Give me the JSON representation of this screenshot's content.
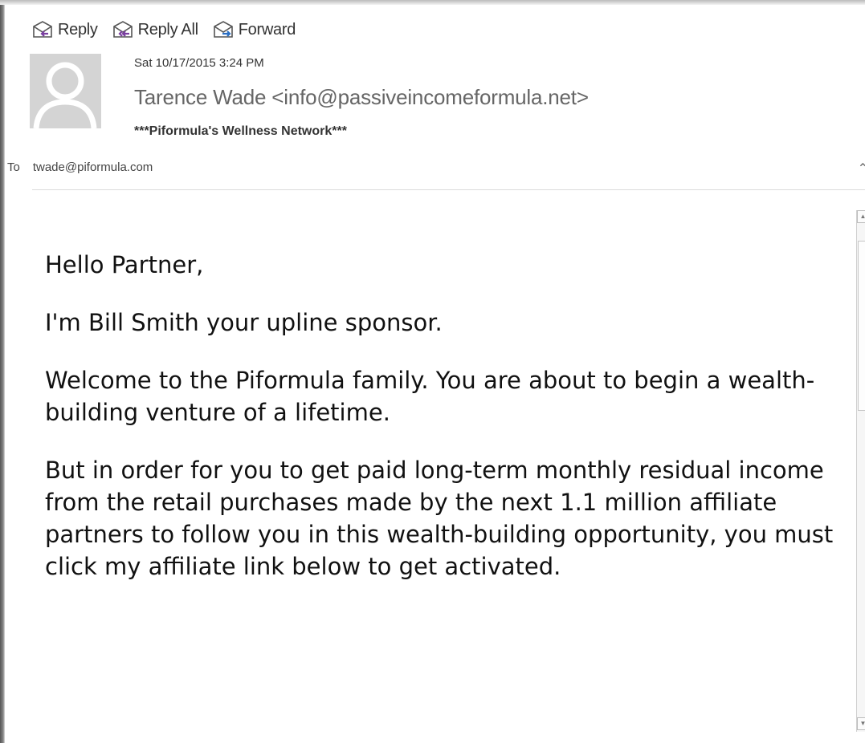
{
  "toolbar": {
    "reply": "Reply",
    "reply_all": "Reply All",
    "forward": "Forward"
  },
  "header": {
    "date": "Sat 10/17/2015 3:24 PM",
    "sender": "Tarence Wade <info@passiveincomeformula.net>",
    "subject": "***Piformula's Wellness Network***",
    "to_label": "To",
    "to_address": "twade@piformula.com"
  },
  "body": {
    "p1": "Hello Partner,",
    "p2": "I'm Bill Smith your upline sponsor.",
    "p3": "Welcome to the Piformula family. You are about to begin a wealth-building venture of a lifetime.",
    "p4": "But in order for you to get paid long-term monthly residual income from the retail purchases made by the next 1.1 million affiliate partners to follow you in this wealth-building opportunity, you must click my affiliate link below to get activated."
  },
  "icons": {
    "reply": "reply-icon",
    "reply_all": "reply-all-icon",
    "forward": "forward-icon",
    "avatar": "person-avatar",
    "colors": {
      "reply_arrow": "#7a3fa0",
      "forward_arrow": "#2a6fc4"
    }
  }
}
